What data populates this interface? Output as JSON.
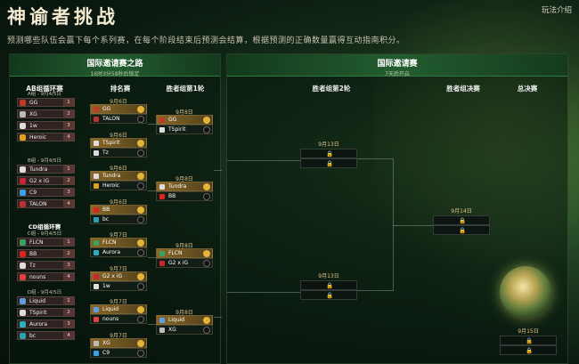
{
  "title": "神谕者挑战",
  "help_link": "玩法介绍",
  "subtitle": "预测哪些队伍会赢下每个系列赛，在每个阶段结束后预测会结算，根据预测的正确数量赢得互动指南积分。",
  "colors": {
    "accent": "#2f7a3e",
    "gold": "#e3b33a"
  },
  "left_panel": {
    "title": "国际邀请赛之路",
    "countdown": "16时3分58秒后锁定",
    "headers": {
      "groups": "AB组循环赛",
      "seeding": "排名赛",
      "round1": "胜者组第1轮"
    },
    "groups": [
      {
        "label": "A组",
        "dates": "A组 - 9月4/5日",
        "teams": [
          {
            "name": "GG",
            "rank": "1"
          },
          {
            "name": "XG",
            "rank": "2"
          },
          {
            "name": "1w",
            "rank": "3"
          },
          {
            "name": "Heroic",
            "rank": "4"
          }
        ]
      },
      {
        "label": "B组",
        "dates": "B组 - 9月4/5日",
        "teams": [
          {
            "name": "Tundra",
            "rank": "1"
          },
          {
            "name": "G2 x iG",
            "rank": "2"
          },
          {
            "name": "C9",
            "rank": "3"
          },
          {
            "name": "TALON",
            "rank": "4"
          }
        ]
      },
      {
        "label": "CD组循环赛",
        "dates": "C组 - 9月4/5日",
        "teams": [
          {
            "name": "FLCN",
            "rank": "1"
          },
          {
            "name": "BB",
            "rank": "2"
          },
          {
            "name": "Tz",
            "rank": "3"
          },
          {
            "name": "nouns",
            "rank": "4"
          }
        ]
      },
      {
        "label": "D组",
        "dates": "D组 - 9月4/5日",
        "teams": [
          {
            "name": "Liquid",
            "rank": "1"
          },
          {
            "name": "TSpirit",
            "rank": "2"
          },
          {
            "name": "Aurora",
            "rank": "3"
          },
          {
            "name": "bc",
            "rank": "4"
          }
        ]
      }
    ],
    "seeding": [
      {
        "date": "9月6日",
        "a": "GG",
        "b": "TALON"
      },
      {
        "date": "9月6日",
        "a": "TSpirit",
        "b": "Tz"
      },
      {
        "date": "9月6日",
        "a": "Tundra",
        "b": "Heroic"
      },
      {
        "date": "9月6日",
        "a": "BB",
        "b": "bc"
      },
      {
        "date": "9月7日",
        "a": "FLCN",
        "b": "Aurora"
      },
      {
        "date": "9月7日",
        "a": "G2 x iG",
        "b": "1w"
      },
      {
        "date": "9月7日",
        "a": "Liquid",
        "b": "nouns"
      },
      {
        "date": "9月7日",
        "a": "XG",
        "b": "C9"
      }
    ],
    "round1": [
      {
        "date": "9月8日",
        "a": "GG",
        "b": "TSpirit"
      },
      {
        "date": "9月8日",
        "a": "Tundra",
        "b": "BB"
      },
      {
        "date": "9月8日",
        "a": "FLCN",
        "b": "G2 x iG"
      },
      {
        "date": "9月8日",
        "a": "Liquid",
        "b": "XG"
      }
    ]
  },
  "right_panel": {
    "title": "国际邀请赛",
    "countdown": "7天后开启",
    "headers": {
      "round2": "胜者组第2轮",
      "final_upper": "胜者组决赛",
      "grand_final": "总决赛"
    },
    "round2": [
      {
        "date": "9月13日"
      },
      {
        "date": "9月13日"
      }
    ],
    "upper_final": {
      "date": "9月14日"
    },
    "grand_final": {
      "date": "9月15日"
    }
  }
}
